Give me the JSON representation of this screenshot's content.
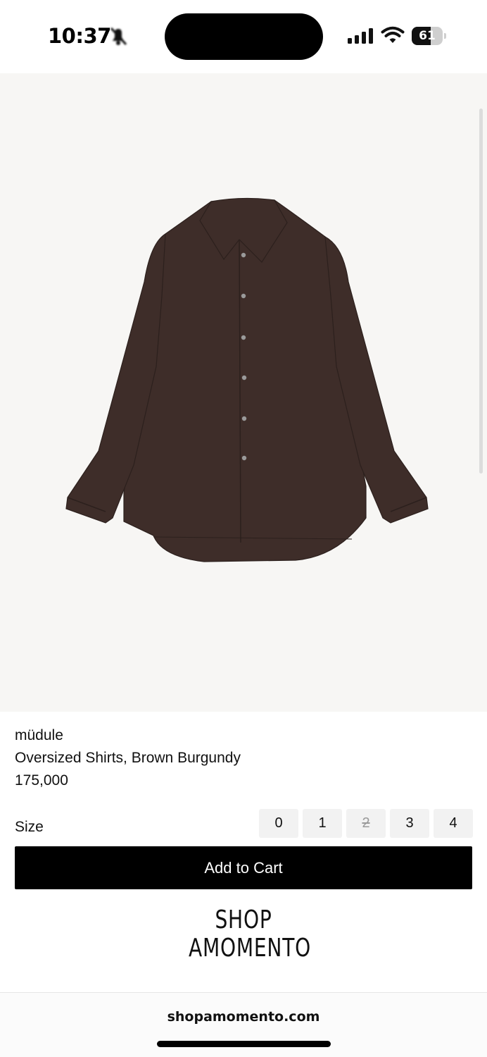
{
  "status_bar": {
    "time": "10:37",
    "battery": "61",
    "battery_level": 0.61,
    "icons": [
      "bell-muted-icon",
      "signal-icon",
      "wifi-icon",
      "battery-icon"
    ]
  },
  "product": {
    "brand": "müdule",
    "name": "Oversized Shirts, Brown Burgundy",
    "price": "175,000",
    "color_hex": "#3e2d29",
    "image_background": "#f7f6f4"
  },
  "size": {
    "label": "Size",
    "options": [
      {
        "label": "0",
        "available": true
      },
      {
        "label": "1",
        "available": true
      },
      {
        "label": "2",
        "available": false
      },
      {
        "label": "3",
        "available": true
      },
      {
        "label": "4",
        "available": true
      }
    ]
  },
  "cart": {
    "add_label": "Add to Cart",
    "button_color": "#000000"
  },
  "logo": {
    "line1": "SHOP",
    "line2": "AMOMENTO"
  },
  "browser": {
    "url": "shopamomento.com"
  }
}
